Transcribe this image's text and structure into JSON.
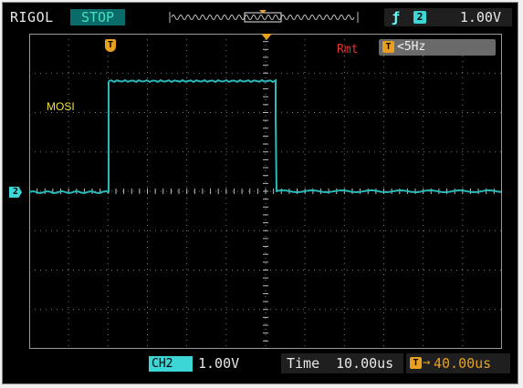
{
  "header": {
    "brand": "RIGOL",
    "run_state": "STOP",
    "trigger": {
      "edge_icon": "rising-edge-icon",
      "channel": "2",
      "level": "1.00V"
    }
  },
  "screen": {
    "trigger_marker": "T",
    "channel_marker": "2",
    "signal_label": "MOSI",
    "rmt": "Rmt",
    "freq_icon": "T",
    "freq_text": "<5Hz"
  },
  "footer": {
    "channel_tag": "CH2",
    "channel_scale": "1.00V",
    "time_label": "Time",
    "time_value": "10.00us",
    "delay_icon": "T",
    "delay_arrow": "→",
    "delay_value": "40.00us"
  },
  "colors": {
    "trace": "#2ab8b8",
    "grid": "#7a7a7a",
    "accent": "#e8a020",
    "status": "#0a6b6b"
  }
}
